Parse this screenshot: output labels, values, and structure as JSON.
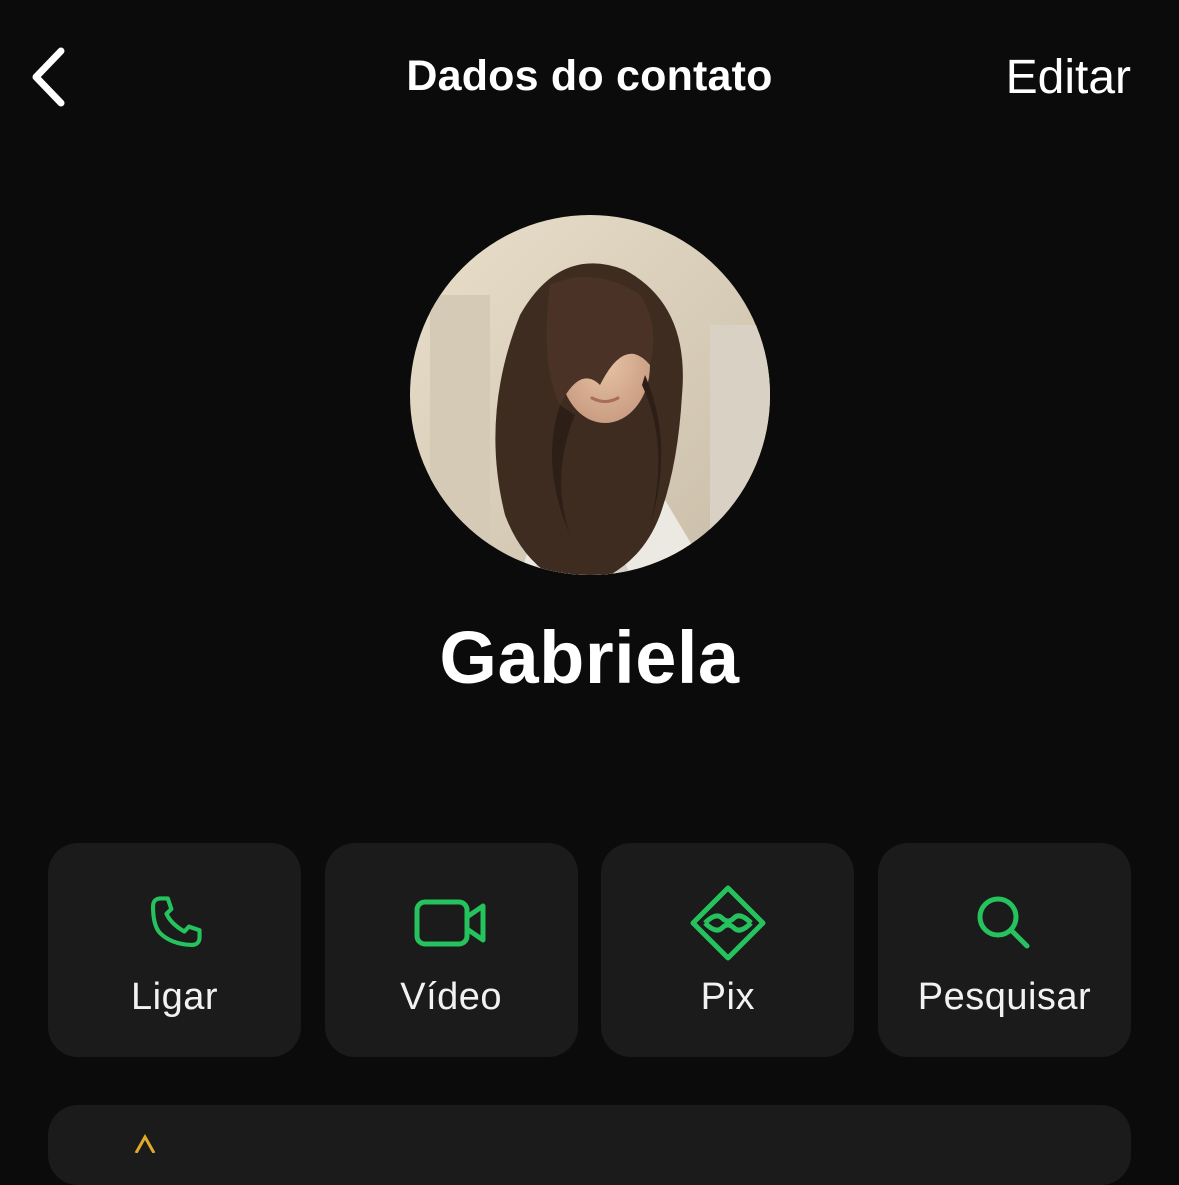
{
  "nav": {
    "title": "Dados do contato",
    "edit_label": "Editar",
    "back_icon": "chevron-left-icon"
  },
  "contact": {
    "name": "Gabriela",
    "avatar": "profile-photo"
  },
  "actions": [
    {
      "label": "Ligar",
      "icon": "phone-icon"
    },
    {
      "label": "Vídeo",
      "icon": "video-camera-icon"
    },
    {
      "label": "Pix",
      "icon": "pix-icon"
    },
    {
      "label": "Pesquisar",
      "icon": "search-icon"
    }
  ],
  "colors": {
    "background": "#0b0b0b",
    "card": "#1b1b1b",
    "accent": "#25c25e",
    "text": "#ffffff"
  }
}
